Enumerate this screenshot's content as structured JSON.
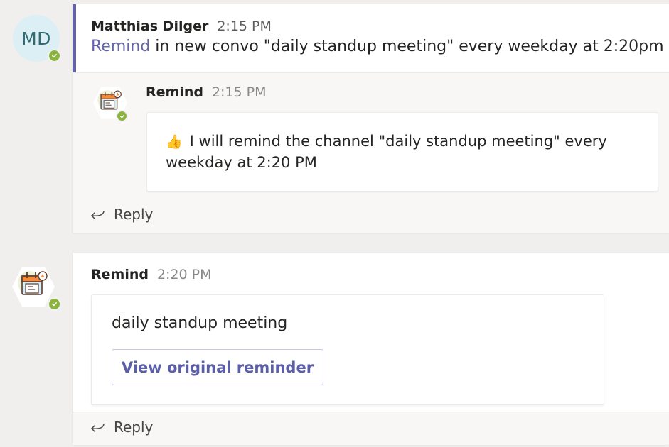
{
  "messages": [
    {
      "sender": "Matthias Dilger",
      "initials": "MD",
      "time": "2:15 PM",
      "mention": "Remind",
      "text": " in new convo \"daily standup meeting\" every weekday at 2:20pm",
      "presence": "available",
      "replies": [
        {
          "sender": "Remind",
          "time": "2:15 PM",
          "emoji": "👍",
          "text": "I will remind the channel \"daily standup meeting\" every weekday at 2:20 PM",
          "presence": "available"
        }
      ],
      "reply_label": "Reply"
    },
    {
      "sender": "Remind",
      "time": "2:20 PM",
      "card_title": "daily standup meeting",
      "card_button": "View original reminder",
      "presence": "available",
      "reply_label": "Reply"
    }
  ],
  "colors": {
    "accent": "#6264a7",
    "presence_available": "#8ab43f",
    "avatar_bg": "#dbeff5",
    "avatar_text": "#2f6d73"
  },
  "icons": {
    "presence": "check-icon",
    "reply": "reply-arrow-icon",
    "bot": "calendar-reminder-bot-icon"
  }
}
